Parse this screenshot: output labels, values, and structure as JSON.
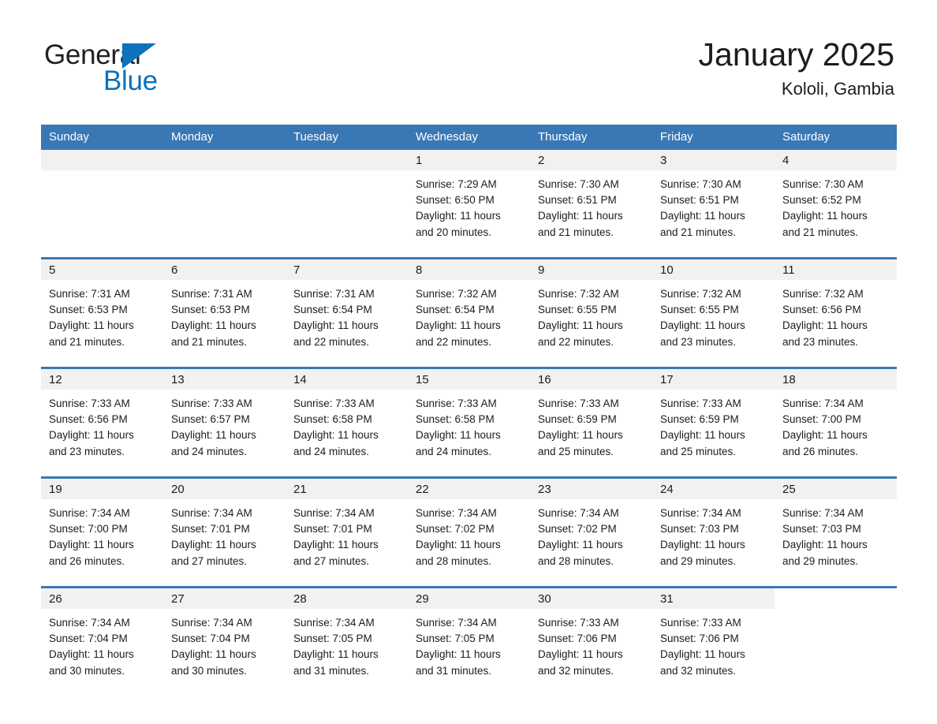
{
  "brand": {
    "name_top": "General",
    "name_bottom": "Blue",
    "triangle_color": "#0b72bb",
    "text_color": "#231f20"
  },
  "header": {
    "title": "January 2025",
    "subtitle": "Kololi, Gambia"
  },
  "theme": {
    "header_blue": "#3a78b5",
    "daynum_band": "#f1f1f1",
    "text": "#1c1c1c",
    "page_bg": "#ffffff"
  },
  "weekdays": [
    {
      "label": "Sunday"
    },
    {
      "label": "Monday"
    },
    {
      "label": "Tuesday"
    },
    {
      "label": "Wednesday"
    },
    {
      "label": "Thursday"
    },
    {
      "label": "Friday"
    },
    {
      "label": "Saturday"
    }
  ],
  "weeks": [
    {
      "days": [
        {
          "num": "",
          "sunrise": "",
          "sunset": "",
          "daylight_1": "",
          "daylight_2": "",
          "empty": true
        },
        {
          "num": "",
          "sunrise": "",
          "sunset": "",
          "daylight_1": "",
          "daylight_2": "",
          "empty": true
        },
        {
          "num": "",
          "sunrise": "",
          "sunset": "",
          "daylight_1": "",
          "daylight_2": "",
          "empty": true
        },
        {
          "num": "1",
          "sunrise": "Sunrise: 7:29 AM",
          "sunset": "Sunset: 6:50 PM",
          "daylight_1": "Daylight: 11 hours",
          "daylight_2": "and 20 minutes."
        },
        {
          "num": "2",
          "sunrise": "Sunrise: 7:30 AM",
          "sunset": "Sunset: 6:51 PM",
          "daylight_1": "Daylight: 11 hours",
          "daylight_2": "and 21 minutes."
        },
        {
          "num": "3",
          "sunrise": "Sunrise: 7:30 AM",
          "sunset": "Sunset: 6:51 PM",
          "daylight_1": "Daylight: 11 hours",
          "daylight_2": "and 21 minutes."
        },
        {
          "num": "4",
          "sunrise": "Sunrise: 7:30 AM",
          "sunset": "Sunset: 6:52 PM",
          "daylight_1": "Daylight: 11 hours",
          "daylight_2": "and 21 minutes."
        }
      ]
    },
    {
      "days": [
        {
          "num": "5",
          "sunrise": "Sunrise: 7:31 AM",
          "sunset": "Sunset: 6:53 PM",
          "daylight_1": "Daylight: 11 hours",
          "daylight_2": "and 21 minutes."
        },
        {
          "num": "6",
          "sunrise": "Sunrise: 7:31 AM",
          "sunset": "Sunset: 6:53 PM",
          "daylight_1": "Daylight: 11 hours",
          "daylight_2": "and 21 minutes."
        },
        {
          "num": "7",
          "sunrise": "Sunrise: 7:31 AM",
          "sunset": "Sunset: 6:54 PM",
          "daylight_1": "Daylight: 11 hours",
          "daylight_2": "and 22 minutes."
        },
        {
          "num": "8",
          "sunrise": "Sunrise: 7:32 AM",
          "sunset": "Sunset: 6:54 PM",
          "daylight_1": "Daylight: 11 hours",
          "daylight_2": "and 22 minutes."
        },
        {
          "num": "9",
          "sunrise": "Sunrise: 7:32 AM",
          "sunset": "Sunset: 6:55 PM",
          "daylight_1": "Daylight: 11 hours",
          "daylight_2": "and 22 minutes."
        },
        {
          "num": "10",
          "sunrise": "Sunrise: 7:32 AM",
          "sunset": "Sunset: 6:55 PM",
          "daylight_1": "Daylight: 11 hours",
          "daylight_2": "and 23 minutes."
        },
        {
          "num": "11",
          "sunrise": "Sunrise: 7:32 AM",
          "sunset": "Sunset: 6:56 PM",
          "daylight_1": "Daylight: 11 hours",
          "daylight_2": "and 23 minutes."
        }
      ]
    },
    {
      "days": [
        {
          "num": "12",
          "sunrise": "Sunrise: 7:33 AM",
          "sunset": "Sunset: 6:56 PM",
          "daylight_1": "Daylight: 11 hours",
          "daylight_2": "and 23 minutes."
        },
        {
          "num": "13",
          "sunrise": "Sunrise: 7:33 AM",
          "sunset": "Sunset: 6:57 PM",
          "daylight_1": "Daylight: 11 hours",
          "daylight_2": "and 24 minutes."
        },
        {
          "num": "14",
          "sunrise": "Sunrise: 7:33 AM",
          "sunset": "Sunset: 6:58 PM",
          "daylight_1": "Daylight: 11 hours",
          "daylight_2": "and 24 minutes."
        },
        {
          "num": "15",
          "sunrise": "Sunrise: 7:33 AM",
          "sunset": "Sunset: 6:58 PM",
          "daylight_1": "Daylight: 11 hours",
          "daylight_2": "and 24 minutes."
        },
        {
          "num": "16",
          "sunrise": "Sunrise: 7:33 AM",
          "sunset": "Sunset: 6:59 PM",
          "daylight_1": "Daylight: 11 hours",
          "daylight_2": "and 25 minutes."
        },
        {
          "num": "17",
          "sunrise": "Sunrise: 7:33 AM",
          "sunset": "Sunset: 6:59 PM",
          "daylight_1": "Daylight: 11 hours",
          "daylight_2": "and 25 minutes."
        },
        {
          "num": "18",
          "sunrise": "Sunrise: 7:34 AM",
          "sunset": "Sunset: 7:00 PM",
          "daylight_1": "Daylight: 11 hours",
          "daylight_2": "and 26 minutes."
        }
      ]
    },
    {
      "days": [
        {
          "num": "19",
          "sunrise": "Sunrise: 7:34 AM",
          "sunset": "Sunset: 7:00 PM",
          "daylight_1": "Daylight: 11 hours",
          "daylight_2": "and 26 minutes."
        },
        {
          "num": "20",
          "sunrise": "Sunrise: 7:34 AM",
          "sunset": "Sunset: 7:01 PM",
          "daylight_1": "Daylight: 11 hours",
          "daylight_2": "and 27 minutes."
        },
        {
          "num": "21",
          "sunrise": "Sunrise: 7:34 AM",
          "sunset": "Sunset: 7:01 PM",
          "daylight_1": "Daylight: 11 hours",
          "daylight_2": "and 27 minutes."
        },
        {
          "num": "22",
          "sunrise": "Sunrise: 7:34 AM",
          "sunset": "Sunset: 7:02 PM",
          "daylight_1": "Daylight: 11 hours",
          "daylight_2": "and 28 minutes."
        },
        {
          "num": "23",
          "sunrise": "Sunrise: 7:34 AM",
          "sunset": "Sunset: 7:02 PM",
          "daylight_1": "Daylight: 11 hours",
          "daylight_2": "and 28 minutes."
        },
        {
          "num": "24",
          "sunrise": "Sunrise: 7:34 AM",
          "sunset": "Sunset: 7:03 PM",
          "daylight_1": "Daylight: 11 hours",
          "daylight_2": "and 29 minutes."
        },
        {
          "num": "25",
          "sunrise": "Sunrise: 7:34 AM",
          "sunset": "Sunset: 7:03 PM",
          "daylight_1": "Daylight: 11 hours",
          "daylight_2": "and 29 minutes."
        }
      ]
    },
    {
      "days": [
        {
          "num": "26",
          "sunrise": "Sunrise: 7:34 AM",
          "sunset": "Sunset: 7:04 PM",
          "daylight_1": "Daylight: 11 hours",
          "daylight_2": "and 30 minutes."
        },
        {
          "num": "27",
          "sunrise": "Sunrise: 7:34 AM",
          "sunset": "Sunset: 7:04 PM",
          "daylight_1": "Daylight: 11 hours",
          "daylight_2": "and 30 minutes."
        },
        {
          "num": "28",
          "sunrise": "Sunrise: 7:34 AM",
          "sunset": "Sunset: 7:05 PM",
          "daylight_1": "Daylight: 11 hours",
          "daylight_2": "and 31 minutes."
        },
        {
          "num": "29",
          "sunrise": "Sunrise: 7:34 AM",
          "sunset": "Sunset: 7:05 PM",
          "daylight_1": "Daylight: 11 hours",
          "daylight_2": "and 31 minutes."
        },
        {
          "num": "30",
          "sunrise": "Sunrise: 7:33 AM",
          "sunset": "Sunset: 7:06 PM",
          "daylight_1": "Daylight: 11 hours",
          "daylight_2": "and 32 minutes."
        },
        {
          "num": "31",
          "sunrise": "Sunrise: 7:33 AM",
          "sunset": "Sunset: 7:06 PM",
          "daylight_1": "Daylight: 11 hours",
          "daylight_2": "and 32 minutes."
        },
        {
          "num": "",
          "sunrise": "",
          "sunset": "",
          "daylight_1": "",
          "daylight_2": "",
          "blank": true
        }
      ]
    }
  ]
}
